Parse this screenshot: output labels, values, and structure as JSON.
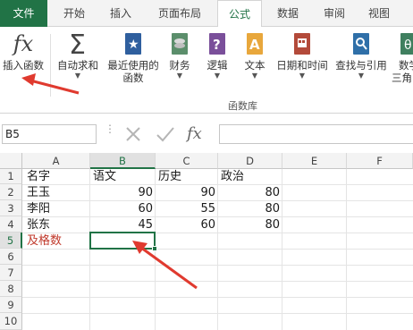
{
  "tabs": [
    {
      "label": "文件",
      "active": false,
      "file": true
    },
    {
      "label": "开始",
      "active": false
    },
    {
      "label": "插入",
      "active": false
    },
    {
      "label": "页面布局",
      "active": false
    },
    {
      "label": "公式",
      "active": true
    },
    {
      "label": "数据",
      "active": false
    },
    {
      "label": "审阅",
      "active": false
    },
    {
      "label": "视图",
      "active": false
    }
  ],
  "ribbon": {
    "insert_function": {
      "icon": "fx",
      "label": "插入函数"
    },
    "autosum": {
      "label": "自动求和"
    },
    "recent_used": {
      "label1": "最近使用的",
      "label2": "函数"
    },
    "financial": {
      "label": "财务"
    },
    "logical": {
      "label": "逻辑"
    },
    "text": {
      "label": "文本"
    },
    "datetime": {
      "label": "日期和时间"
    },
    "lookup": {
      "label": "查找与引用"
    },
    "math": {
      "label1": "数学",
      "label2": "三角"
    },
    "group_label": "函数库"
  },
  "formula_bar": {
    "name_box": "B5",
    "fx_label": "fx",
    "formula": ""
  },
  "grid": {
    "columns": [
      "A",
      "B",
      "C",
      "D",
      "E",
      "F"
    ],
    "selected_column": "B",
    "rows": [
      "1",
      "2",
      "3",
      "4",
      "5",
      "6",
      "7",
      "8",
      "9",
      "10"
    ],
    "selected_row": "5",
    "cells": {
      "A1": "名字",
      "B1": "语文",
      "C1": "历史",
      "D1": "政治",
      "A2": "王玉",
      "B2": "90",
      "C2": "90",
      "D2": "80",
      "A3": "李阳",
      "B3": "60",
      "C3": "55",
      "D3": "80",
      "A4": "张东",
      "B4": "45",
      "C4": "60",
      "D4": "80",
      "A5": "及格数"
    }
  },
  "colors": {
    "accent": "#217346",
    "arrow": "#e03a2f",
    "red_text": "#c0392b"
  }
}
